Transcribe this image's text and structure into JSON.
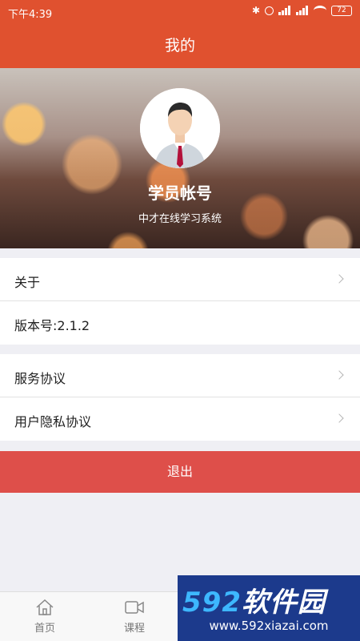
{
  "status_bar": {
    "time": "下午4:39",
    "battery": "72"
  },
  "header": {
    "title": "我的"
  },
  "profile": {
    "name": "学员帐号",
    "subtitle": "中才在线学习系统"
  },
  "menu": {
    "about": "关于",
    "version": "版本号:2.1.2",
    "service_agreement": "服务协议",
    "privacy_agreement": "用户隐私协议"
  },
  "logout_label": "退出",
  "bottom_nav": {
    "home": "首页",
    "course": "课程"
  },
  "watermark": {
    "number": "592",
    "name": "软件园",
    "url": "www.592xiazai.com"
  },
  "colors": {
    "brand": "#e0512f",
    "logout": "#de4f4a"
  }
}
